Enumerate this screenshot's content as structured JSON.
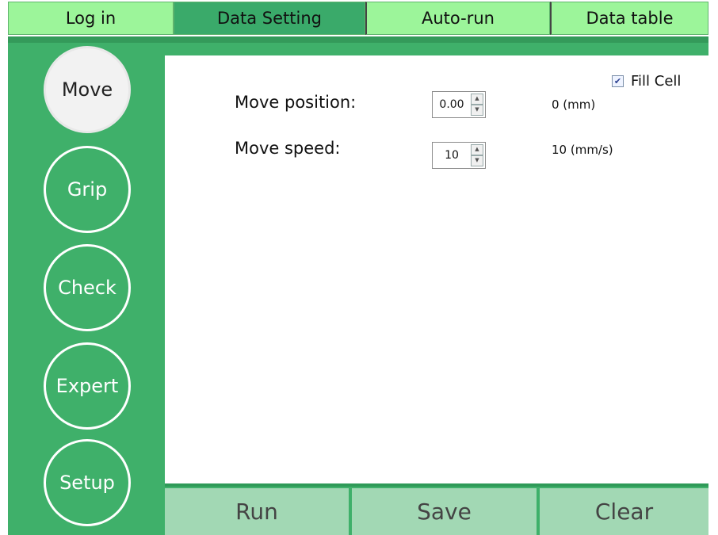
{
  "tabs": [
    {
      "label": "Log in"
    },
    {
      "label": "Data Setting"
    },
    {
      "label": "Auto-run"
    },
    {
      "label": "Data table"
    }
  ],
  "sidebar": {
    "items": [
      {
        "label": "Move"
      },
      {
        "label": "Grip"
      },
      {
        "label": "Check"
      },
      {
        "label": "Expert"
      },
      {
        "label": "Setup"
      }
    ]
  },
  "content": {
    "fill_cell": {
      "label": "Fill Cell",
      "checked": true
    },
    "move_position": {
      "label": "Move position:",
      "value": "0.00",
      "readout": "0 (mm)"
    },
    "move_speed": {
      "label": "Move speed:",
      "value": "10",
      "readout": "10 (mm/s)"
    }
  },
  "actions": {
    "run": "Run",
    "save": "Save",
    "clear": "Clear"
  },
  "colors": {
    "tab_bg": "#9cf59a",
    "tab_active": "#3aaa6a",
    "frame_green": "#3fb06a",
    "action_button": "#a2d8b4"
  },
  "icons": {
    "checkbox": "check-icon",
    "spin_up": "arrow-up-icon",
    "spin_down": "arrow-down-icon"
  }
}
